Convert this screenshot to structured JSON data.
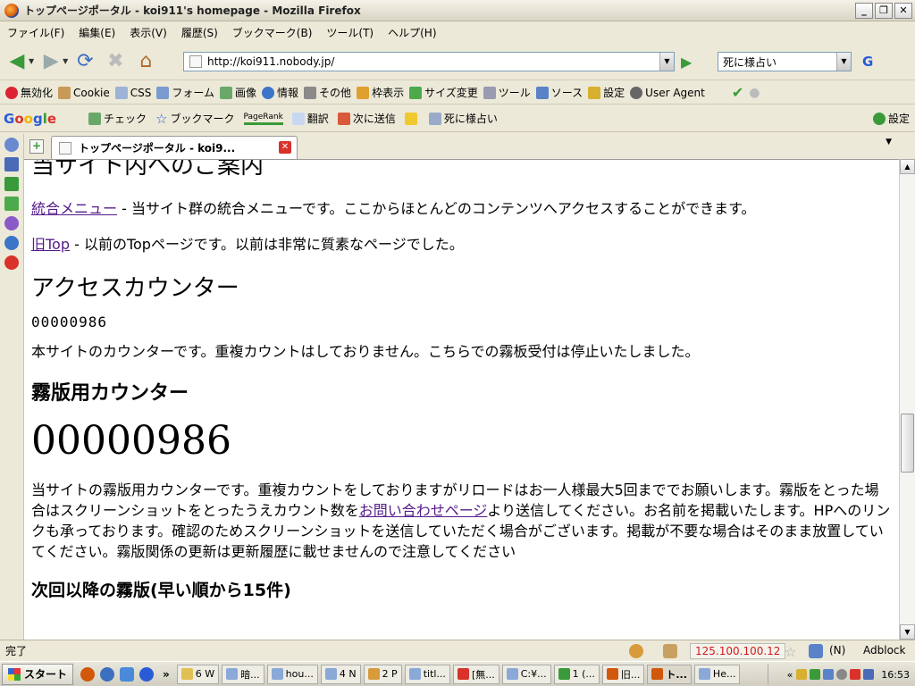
{
  "window": {
    "title": "トップページポータル - koi911's homepage - Mozilla Firefox"
  },
  "menu": [
    "ファイル(F)",
    "編集(E)",
    "表示(V)",
    "履歴(S)",
    "ブックマーク(B)",
    "ツール(T)",
    "ヘルプ(H)"
  ],
  "nav": {
    "url": "http://koi911.nobody.jp/",
    "search_text": "死に様占い",
    "search_engine_label": "G"
  },
  "webdev_toolbar": [
    "無効化",
    "Cookie",
    "CSS",
    "フォーム",
    "画像",
    "情報",
    "その他",
    "枠表示",
    "サイズ変更",
    "ツール",
    "ソース",
    "設定",
    "User Agent"
  ],
  "google_toolbar": {
    "logo": "Google",
    "items": [
      "チェック",
      "ブックマーク",
      "PageRank",
      "翻訳",
      "次に送信",
      "死に様占い"
    ],
    "settings": "設定"
  },
  "tab": {
    "label": "トップページポータル - koi9..."
  },
  "content": {
    "partial_heading": "当サイト内へのご案内",
    "link1": "統合メニュー",
    "link1_desc": " - 当サイト群の統合メニューです。ここからほとんどのコンテンツへアクセスすることができます。",
    "link2": "旧Top",
    "link2_desc": " - 以前のTopページです。以前は非常に質素なページでした。",
    "heading_access": "アクセスカウンター",
    "counter_small": "00000986",
    "counter_desc": "本サイトのカウンターです。重複カウントはしておりません。こちらでの霧板受付は停止いたしました。",
    "heading_kiriban": "霧版用カウンター",
    "counter_big": "00000986",
    "kiriban_desc_1": "当サイトの霧版用カウンターです。重複カウントをしておりますがリロードはお一人様最大5回まででお願いします。霧版をとった場合はスクリーンショットをとったうえカウント数を",
    "kiriban_link": "お問い合わせページ",
    "kiriban_desc_2": "より送信してください。お名前を掲載いたします。HPへのリンクも承っております。確認のためスクリーンショットを送信していただく場合がございます。掲載が不要な場合はそのまま放置していてください。霧版関係の更新は更新履歴に載せませんので注意してください",
    "heading_next": "次回以降の霧版(早い順から15件)"
  },
  "status": {
    "left": "完了",
    "ip": "125.100.100.12",
    "n": "(N)",
    "adblock": "Adblock"
  },
  "taskbar": {
    "start": "スタート",
    "items": [
      "6 W",
      "暗...",
      "hou...",
      "4 N",
      "2 P",
      "titl...",
      "[無...",
      "C:¥...",
      "1 (...",
      "旧...",
      "ト...",
      "He..."
    ],
    "clock": "16:53"
  }
}
